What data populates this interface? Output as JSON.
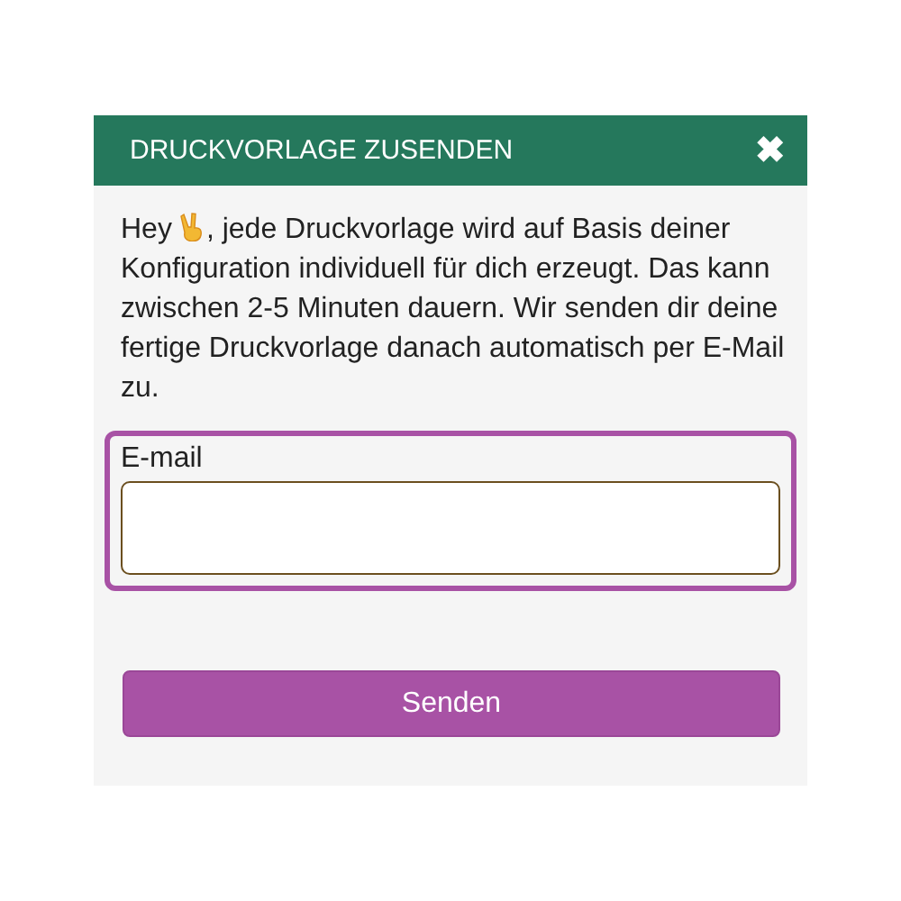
{
  "dialog": {
    "title": "DRUCKVORLAGE ZUSENDEN",
    "close": "✖",
    "intro": {
      "greeting": "Hey",
      "text": ", jede Druckvorlage wird auf Basis deiner Konfiguration individuell für dich erzeugt. Das kann zwischen 2-5 Minuten dauern. Wir senden dir deine fertige Druckvorlage danach automatisch per E-Mail zu."
    },
    "email_field": {
      "label": "E-mail",
      "focused": true
    },
    "submit": "Senden"
  }
}
